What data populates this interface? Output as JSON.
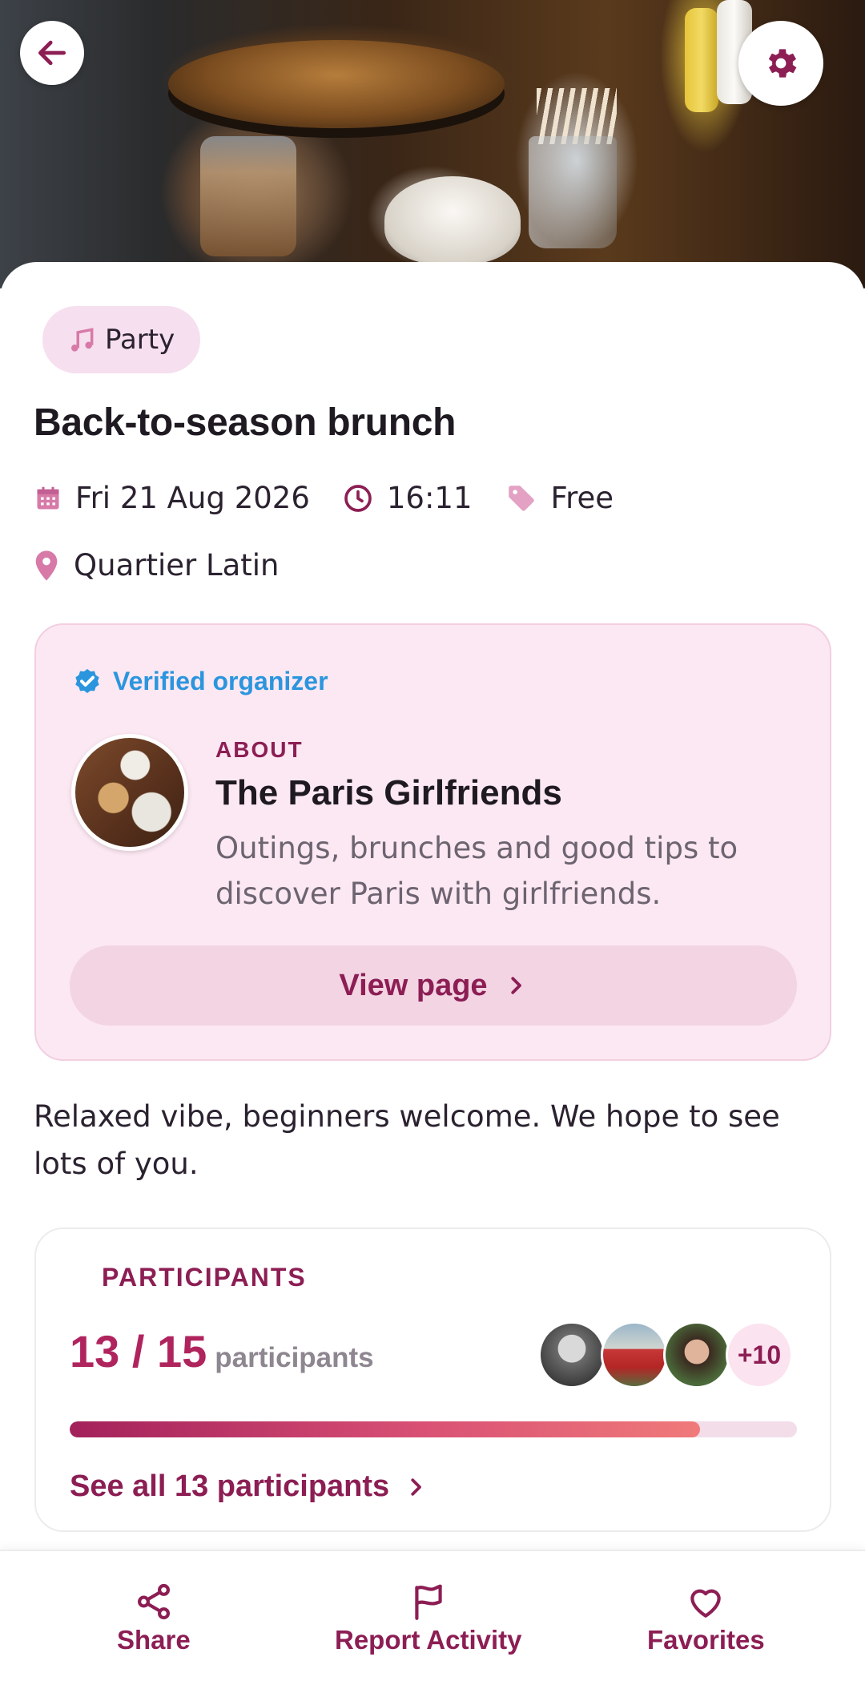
{
  "event": {
    "category": "Party",
    "title": "Back-to-season brunch",
    "date": "Fri 21 Aug 2026",
    "time": "16:11",
    "price": "Free",
    "location": "Quartier Latin",
    "description": "Relaxed vibe, beginners welcome. We hope to see lots of you."
  },
  "organizer": {
    "verified_label": "Verified organizer",
    "about_label": "ABOUT",
    "name": "The Paris Girlfriends",
    "description": "Outings, brunches and good tips to discover Paris with girlfriends.",
    "view_page_label": "View page"
  },
  "participants": {
    "section_label": "PARTICIPANTS",
    "count_text": "13 / 15",
    "count_word": "participants",
    "current": 13,
    "max": 15,
    "fill_fraction": 0.867,
    "more_label": "+10",
    "see_all_label": "See all 13 participants"
  },
  "actions": {
    "share": "Share",
    "report": "Report Activity",
    "favorites": "Favorites"
  },
  "icons": {
    "back": "arrow-left-icon",
    "settings": "gear-icon",
    "category": "music-note-icon",
    "date": "calendar-icon",
    "time": "clock-icon",
    "price": "tag-icon",
    "location": "map-pin-icon",
    "verified": "verified-badge-icon",
    "chevron": "chevron-right-icon",
    "share": "share-icon",
    "report": "flag-icon",
    "favorites": "heart-icon"
  },
  "colors": {
    "accent": "#8c1e54",
    "accent_bright": "#b0245e",
    "verified_blue": "#2b95de",
    "card_pink": "#fce8f2",
    "chip_pink": "#f6dfee",
    "icon_pink": "#d77aa8"
  }
}
